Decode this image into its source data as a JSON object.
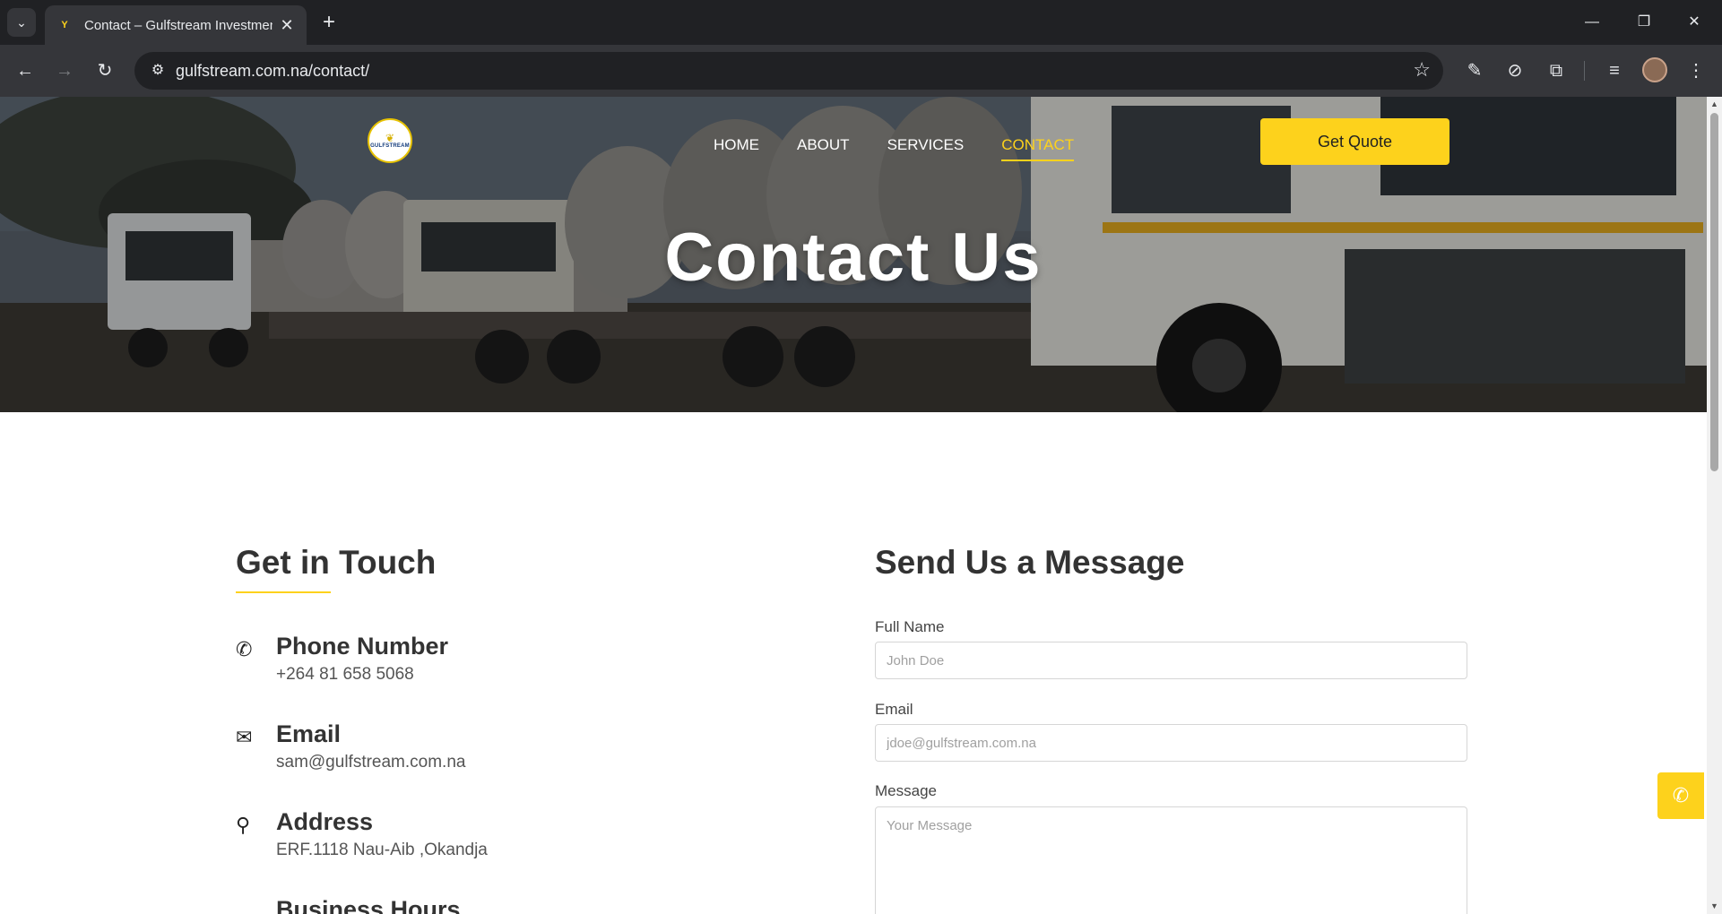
{
  "browser": {
    "tab_title": "Contact – Gulfstream Investments",
    "tab_favicon": "Y",
    "url": "gulfstream.com.na/contact/"
  },
  "header": {
    "logo_text": "GULFSTREAM",
    "nav": [
      "HOME",
      "ABOUT",
      "SERVICES",
      "CONTACT"
    ],
    "active_nav": "CONTACT",
    "quote_label": "Get Quote"
  },
  "hero": {
    "title": "Contact Us"
  },
  "contact": {
    "title": "Get in Touch",
    "items": [
      {
        "icon": "phone-icon",
        "label": "Phone Number",
        "value": "+264 81 658 5068"
      },
      {
        "icon": "envelope-icon",
        "label": "Email",
        "value": "sam@gulfstream.com.na"
      },
      {
        "icon": "map-pin-icon",
        "label": "Address",
        "value": "ERF.1118 Nau-Aib ,Okandja"
      },
      {
        "icon": "clock-icon",
        "label": "Business Hours",
        "value": ""
      }
    ]
  },
  "form": {
    "title": "Send Us a Message",
    "name_label": "Full Name",
    "name_placeholder": "John Doe",
    "email_label": "Email",
    "email_placeholder": "jdoe@gulfstream.com.na",
    "message_label": "Message",
    "message_placeholder": "Your Message"
  },
  "colors": {
    "accent": "#fdd21c",
    "text": "#333333",
    "chrome_dark": "#202124",
    "chrome_toolbar": "#35363a"
  }
}
